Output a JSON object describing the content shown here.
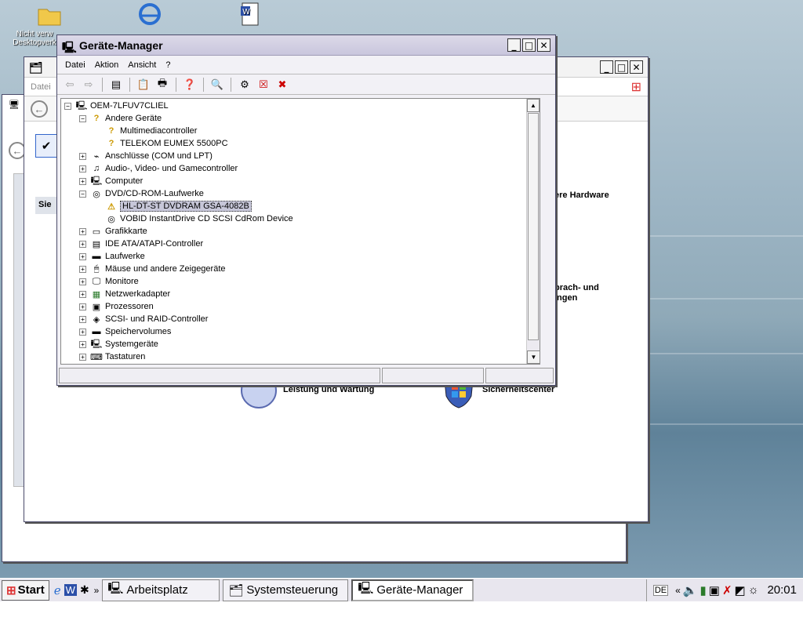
{
  "desktop": {
    "icons": [
      {
        "label_line1": "Nicht verw",
        "label_line2": "Desktopverk"
      }
    ]
  },
  "device_manager": {
    "title": "Geräte-Manager",
    "menu": [
      "Datei",
      "Aktion",
      "Ansicht",
      "?"
    ],
    "tree": {
      "root": "OEM-7LFUV7CLIEL",
      "items": [
        {
          "label": "Andere Geräte",
          "expanded": true,
          "children": [
            "Multimediacontroller",
            "TELEKOM EUMEX 5500PC"
          ]
        },
        {
          "label": "Anschlüsse (COM und LPT)"
        },
        {
          "label": "Audio-, Video- und Gamecontroller"
        },
        {
          "label": "Computer"
        },
        {
          "label": "DVD/CD-ROM-Laufwerke",
          "expanded": true,
          "children": [
            "HL-DT-ST DVDRAM GSA-4082B",
            "VOBID InstantDrive CD SCSI CdRom Device"
          ]
        },
        {
          "label": "Grafikkarte"
        },
        {
          "label": "IDE ATA/ATAPI-Controller"
        },
        {
          "label": "Laufwerke"
        },
        {
          "label": "Mäuse und andere Zeigegeräte"
        },
        {
          "label": "Monitore"
        },
        {
          "label": "Netzwerkadapter"
        },
        {
          "label": "Prozessoren"
        },
        {
          "label": "SCSI- und RAID-Controller"
        },
        {
          "label": "Speichervolumes"
        },
        {
          "label": "Systemgeräte"
        },
        {
          "label": "Tastaturen"
        }
      ],
      "selected": "HL-DT-ST DVDRAM GSA-4082B"
    }
  },
  "control_panel": {
    "menu_first": "Datei",
    "sidebar_heading": "Sie",
    "text_hardware": "ere Hardware",
    "text_sprach_1": "prach- und",
    "text_sprach_2": "ingen",
    "category_leistung": "Leistung und Wartung",
    "category_sicherheit": "Sicherheitscenter"
  },
  "taskbar": {
    "start_label": "Start",
    "tasks": [
      "Arbeitsplatz",
      "Systemsteuerung",
      "Geräte-Manager"
    ],
    "active_task": "Geräte-Manager",
    "language": "DE",
    "clock": "20:01"
  }
}
